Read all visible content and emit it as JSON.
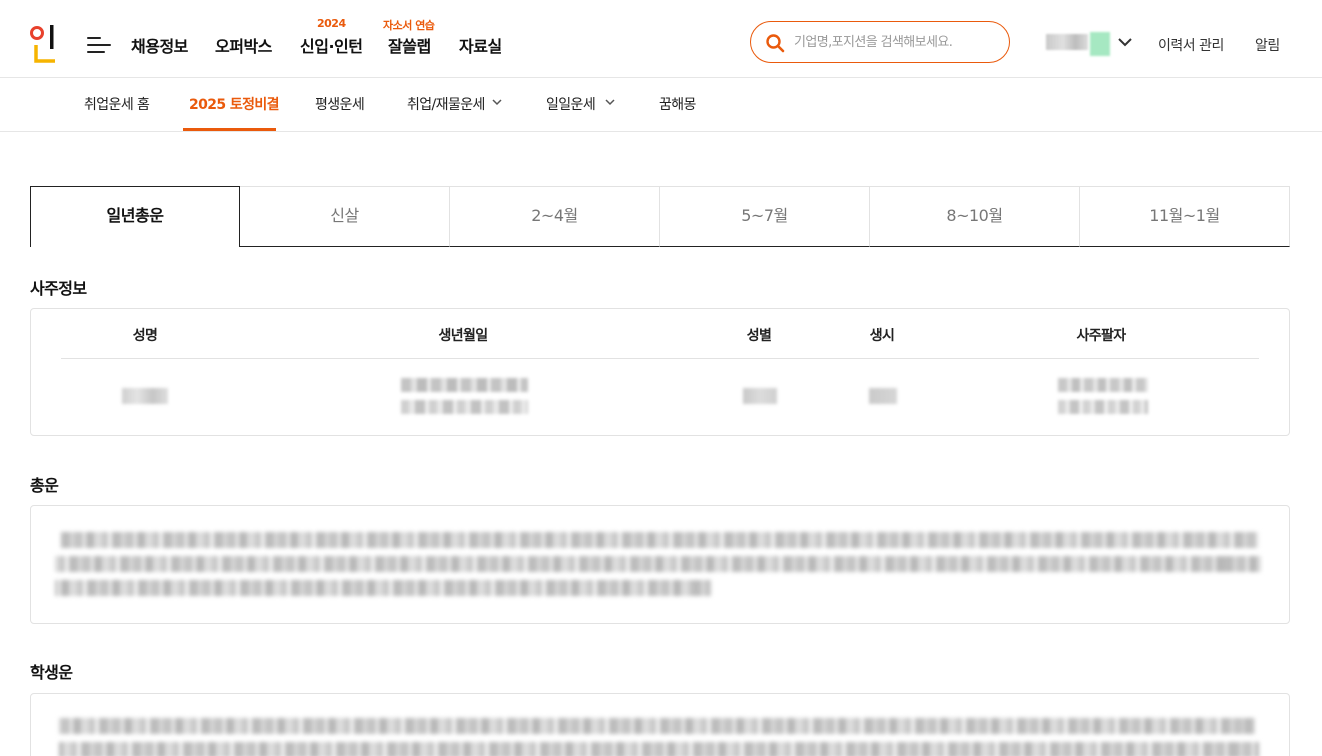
{
  "header": {
    "logo_alt": "인",
    "nav": [
      {
        "label": "채용정보",
        "badge": ""
      },
      {
        "label": "오퍼박스",
        "badge": ""
      },
      {
        "label": "신입·인턴",
        "badge": "2024"
      },
      {
        "label": "잘쓸랩",
        "badge": "자소서 연습"
      },
      {
        "label": "자료실",
        "badge": ""
      }
    ],
    "search_placeholder": "기업명,포지션을 검색해보세요.",
    "util_links": [
      "이력서 관리",
      "알림"
    ]
  },
  "subnav": {
    "items": [
      "취업운세 홈",
      "2025 토정비결",
      "평생운세",
      "취업/재물운세",
      "일일운세",
      "꿈해몽"
    ],
    "active_index": 1
  },
  "tabs": {
    "items": [
      "일년총운",
      "신살",
      "2~4월",
      "5~7월",
      "8~10월",
      "11월~1월"
    ],
    "active_index": 0
  },
  "saju": {
    "title": "사주정보",
    "columns": [
      "성명",
      "생년월일",
      "성별",
      "생시",
      "사주팔자"
    ]
  },
  "sections": {
    "total_title": "총운",
    "student_title": "학생운"
  },
  "colors": {
    "accent": "#ea5a0c",
    "logo_red": "#e8412c",
    "logo_yellow": "#f6b400"
  }
}
